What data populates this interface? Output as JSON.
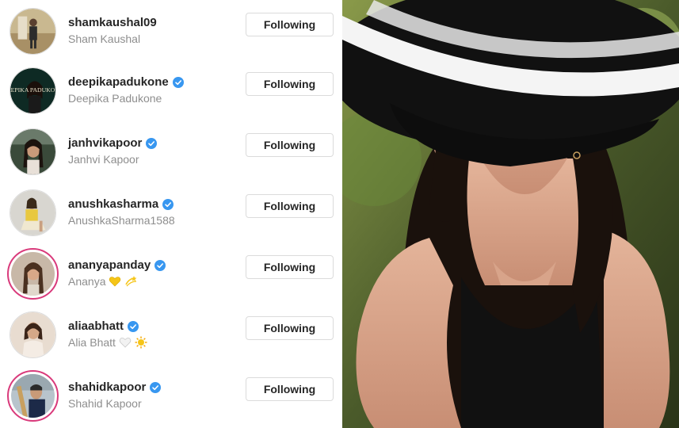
{
  "following_list": [
    {
      "username": "shamkaushal09",
      "full_name": "Sham Kaushal",
      "verified": false,
      "story_ring": false,
      "button_label": "Following",
      "emojis": []
    },
    {
      "username": "deepikapadukone",
      "full_name": "Deepika Padukone",
      "verified": true,
      "story_ring": false,
      "button_label": "Following",
      "emojis": [],
      "avatar_text": "DEEPIKA PADUKONE"
    },
    {
      "username": "janhvikapoor",
      "full_name": "Janhvi Kapoor",
      "verified": true,
      "story_ring": false,
      "button_label": "Following",
      "emojis": []
    },
    {
      "username": "anushkasharma",
      "full_name": "AnushkaSharma1588",
      "verified": true,
      "story_ring": false,
      "button_label": "Following",
      "emojis": []
    },
    {
      "username": "ananyapanday",
      "full_name": "Ananya",
      "verified": true,
      "story_ring": true,
      "button_label": "Following",
      "emojis": [
        "yellow-heart-emoji",
        "dizzy-emoji"
      ]
    },
    {
      "username": "aliaabhatt",
      "full_name": "Alia Bhatt",
      "verified": true,
      "story_ring": false,
      "button_label": "Following",
      "emojis": [
        "white-heart-emoji",
        "sun-emoji"
      ]
    },
    {
      "username": "shahidkapoor",
      "full_name": "Shahid Kapoor",
      "verified": true,
      "story_ring": true,
      "button_label": "Following",
      "emojis": []
    }
  ],
  "colors": {
    "verified_badge": "#3897f0",
    "story_ring": "#d93a7b",
    "username_text": "#262626",
    "fullname_text": "#8e8e8e",
    "button_border": "#dbdbdb"
  },
  "photo": {
    "subject": "woman-in-striped-sun-hat-photo"
  }
}
